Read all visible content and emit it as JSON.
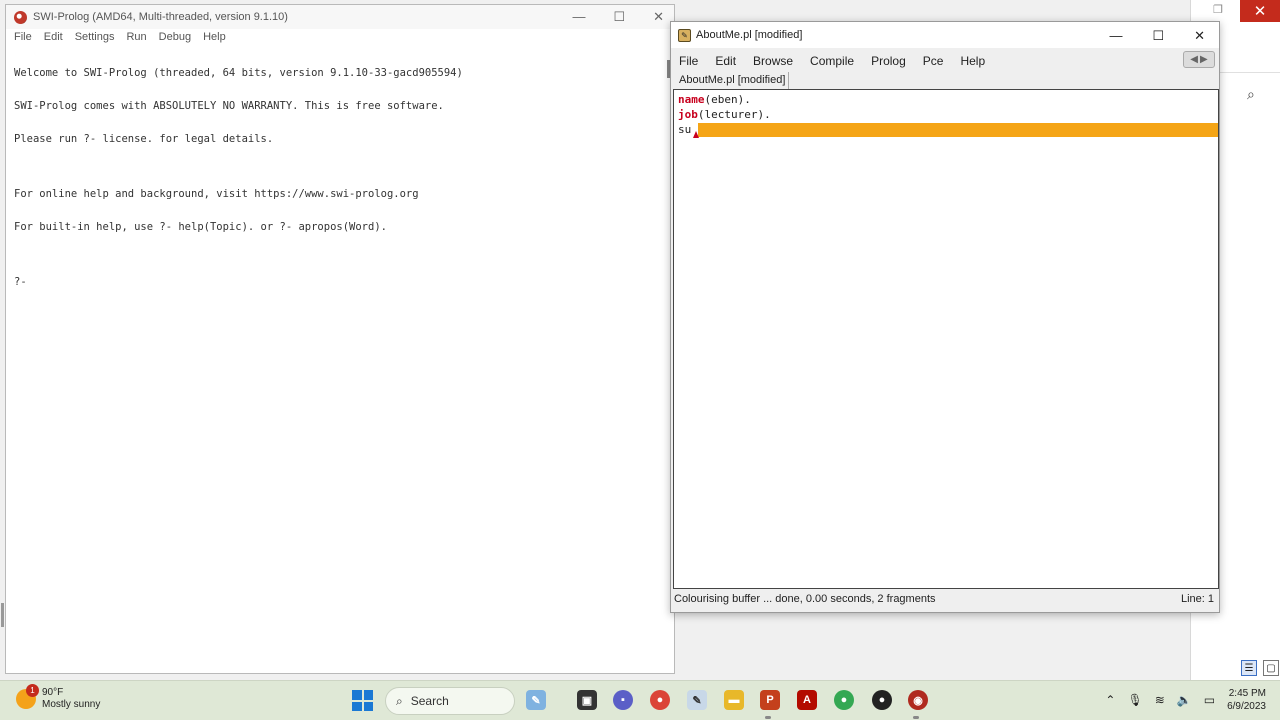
{
  "console": {
    "title": "SWI-Prolog (AMD64, Multi-threaded, version 9.1.10)",
    "menu": [
      "File",
      "Edit",
      "Settings",
      "Run",
      "Debug",
      "Help"
    ],
    "lines": [
      "Welcome to SWI-Prolog (threaded, 64 bits, version 9.1.10-33-gacd905594)",
      "SWI-Prolog comes with ABSOLUTELY NO WARRANTY. This is free software.",
      "Please run ?- license. for legal details.",
      "",
      "For online help and background, visit https://www.swi-prolog.org",
      "For built-in help, use ?- help(Topic). or ?- apropos(Word).",
      "",
      "?-"
    ]
  },
  "editor": {
    "title": "AboutMe.pl [modified]",
    "menu": [
      "File",
      "Edit",
      "Browse",
      "Compile",
      "Prolog",
      "Pce",
      "Help"
    ],
    "tab": "AboutMe.pl [modified]",
    "code": [
      {
        "head": "name",
        "rest": "(eben)."
      },
      {
        "head": "job",
        "rest": "(lecturer)."
      },
      {
        "head": "",
        "rest": "su"
      }
    ],
    "status": "Colourising buffer ... done, 0.00 seconds, 2 fragments",
    "line_info": "Line: 1"
  },
  "taskbar": {
    "weather_temp": "90°F",
    "weather_desc": "Mostly sunny",
    "weather_badge": "1",
    "search_label": "Search",
    "time": "2:45 PM",
    "date": "6/9/2023"
  },
  "colors": {
    "keyword": "#c8001e",
    "highlight": "#f5a516",
    "close_red": "#c42b1c"
  }
}
